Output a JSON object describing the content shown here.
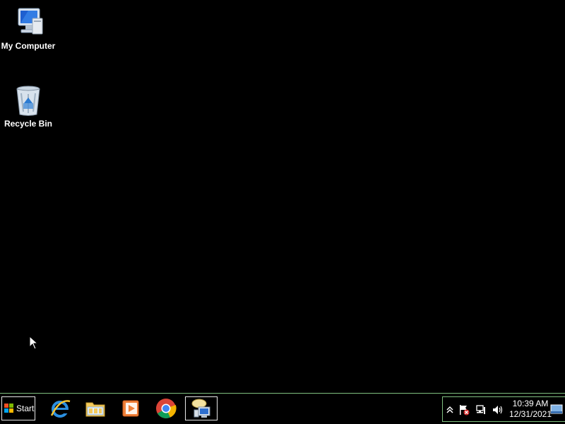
{
  "desktop": {
    "icons": [
      {
        "label": "My Computer",
        "icon": "computer-icon"
      },
      {
        "label": "Recycle Bin",
        "icon": "recycle-bin-icon"
      }
    ]
  },
  "taskbar": {
    "start_label": "Start",
    "apps": [
      {
        "name": "Internet Explorer",
        "icon": "internet-explorer-icon"
      },
      {
        "name": "File Explorer",
        "icon": "folder-icon"
      },
      {
        "name": "Media Player",
        "icon": "media-player-icon"
      },
      {
        "name": "Google Chrome",
        "icon": "chrome-icon"
      },
      {
        "name": "Network app",
        "icon": "network-computer-icon",
        "active": true
      }
    ],
    "tray": {
      "icons": [
        "show-hidden-icon",
        "action-center-flag-icon",
        "network-icon",
        "volume-icon"
      ],
      "time": "10:39 AM",
      "date": "12/31/2021"
    }
  },
  "colors": {
    "background": "#000000",
    "taskbar_border": "#7fbf7f",
    "text": "#ffffff"
  }
}
